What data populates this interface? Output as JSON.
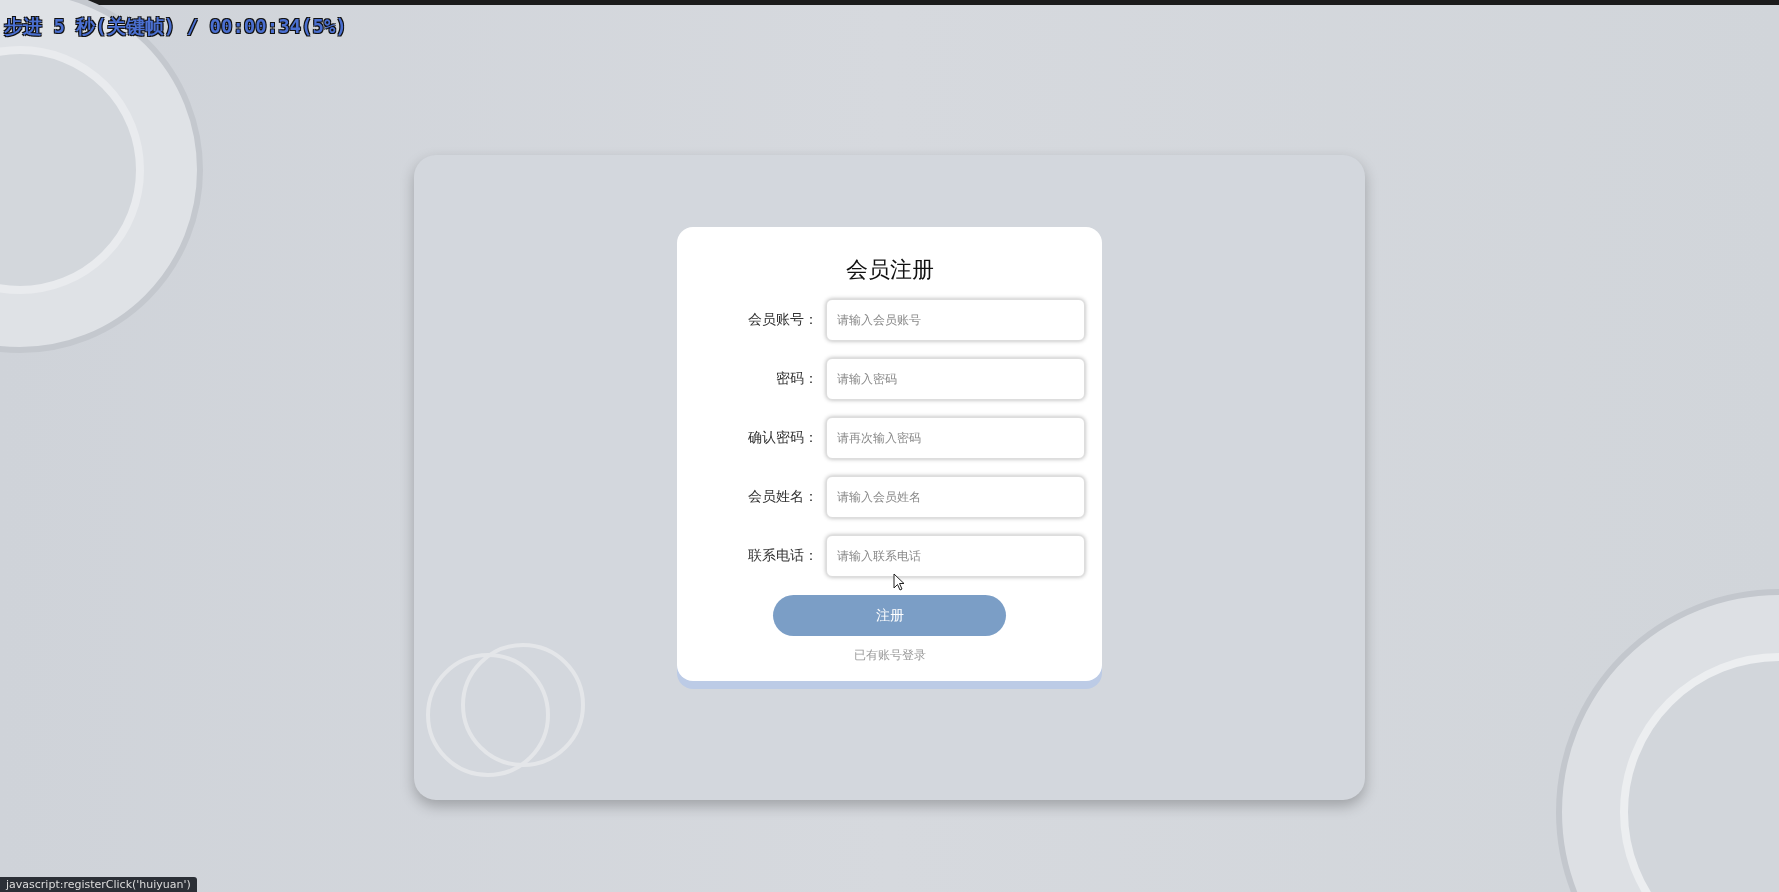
{
  "overlay": {
    "text": "步进 5 秒(关键帧) / 00:00:34(5%)"
  },
  "form": {
    "title": "会员注册",
    "fields": [
      {
        "label": "会员账号：",
        "placeholder": "请输入会员账号"
      },
      {
        "label": "密码：",
        "placeholder": "请输入密码"
      },
      {
        "label": "确认密码：",
        "placeholder": "请再次输入密码"
      },
      {
        "label": "会员姓名：",
        "placeholder": "请输入会员姓名"
      },
      {
        "label": "联系电话：",
        "placeholder": "请输入联系电话"
      }
    ],
    "submit": "注册",
    "login_link": "已有账号登录"
  },
  "status_bar": {
    "text": "javascript:registerClick('huiyuan')"
  }
}
